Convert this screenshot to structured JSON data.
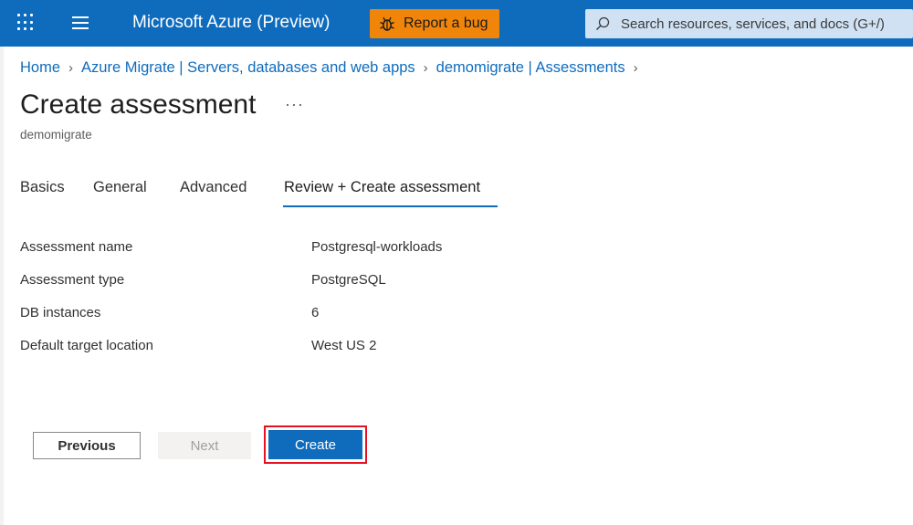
{
  "topbar": {
    "app_title": "Microsoft Azure (Preview)",
    "report_bug_label": "Report a bug",
    "search_placeholder": "Search resources, services, and docs (G+/)",
    "colors": {
      "bar": "#0f6cbd",
      "bug_button": "#f0850a",
      "search_bg": "#cfe1f3"
    }
  },
  "breadcrumb": {
    "items": [
      "Home",
      "Azure Migrate | Servers, databases and web apps",
      "demomigrate | Assessments"
    ]
  },
  "page": {
    "title": "Create assessment",
    "more_label": "···",
    "subtitle": "demomigrate"
  },
  "tabs": [
    {
      "label": "Basics",
      "active": false
    },
    {
      "label": "General",
      "active": false
    },
    {
      "label": "Advanced",
      "active": false
    },
    {
      "label": "Review + Create assessment",
      "active": true
    }
  ],
  "details": [
    {
      "label": "Assessment name",
      "value": "Postgresql-workloads"
    },
    {
      "label": "Assessment type",
      "value": "PostgreSQL"
    },
    {
      "label": "DB instances",
      "value": "6"
    },
    {
      "label": "Default target location",
      "value": "West US 2"
    }
  ],
  "actions": {
    "previous_label": "Previous",
    "next_label": "Next",
    "create_label": "Create",
    "next_disabled": true,
    "create_highlight_color": "#e81123"
  },
  "icons": [
    "waffle-icon",
    "hamburger-icon",
    "bug-icon",
    "search-icon",
    "chevron-right-icon",
    "more-icon"
  ]
}
